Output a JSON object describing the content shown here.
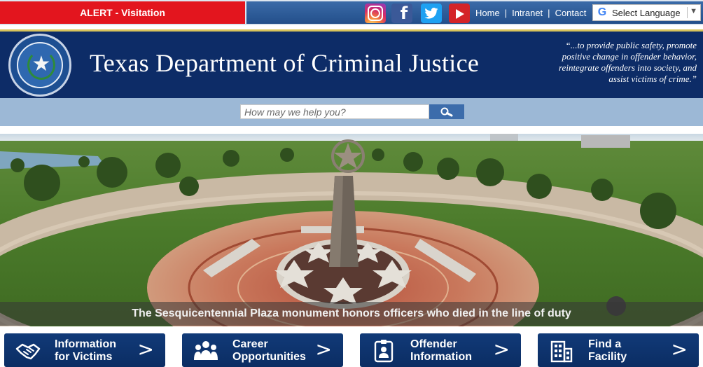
{
  "alert": {
    "label": "ALERT - Visitation"
  },
  "social": [
    {
      "name": "instagram",
      "icon": "instagram-icon"
    },
    {
      "name": "facebook",
      "icon": "facebook-icon",
      "glyph": "f"
    },
    {
      "name": "twitter",
      "icon": "twitter-icon"
    },
    {
      "name": "youtube",
      "icon": "youtube-icon"
    }
  ],
  "nav": {
    "home": "Home",
    "intranet": "Intranet",
    "contact": "Contact",
    "separator": "|"
  },
  "language": {
    "label": "Select Language",
    "google_glyph": "G",
    "arrow": "▼"
  },
  "header": {
    "title": "Texas Department of Criminal Justice",
    "motto_lines": [
      "“...to provide public safety, promote",
      "positive change in offender behavior,",
      "reintegrate offenders into society, and",
      "assist victims of crime.”"
    ],
    "seal_icon": "texas-seal-icon",
    "seal_star": "★"
  },
  "search": {
    "placeholder": "How may we help you?",
    "icon": "search-icon"
  },
  "hero": {
    "caption": "The Sesquicentennial Plaza monument honors officers who died in the line of duty"
  },
  "quick_links": [
    {
      "line1": "Information",
      "line2": "for Victims",
      "icon": "handshake-icon"
    },
    {
      "line1": "Career",
      "line2": "Opportunities",
      "icon": "people-icon"
    },
    {
      "line1": "Offender",
      "line2": "Information",
      "icon": "id-badge-icon"
    },
    {
      "line1": "Find a",
      "line2": "Facility",
      "icon": "building-icon"
    }
  ],
  "chevron": ">",
  "colors": {
    "alert": "#e3151e",
    "header_bg": "#0d2c67",
    "accent_gold": "#d7c35b",
    "search_bar": "#9cb8d6",
    "button_blue": "#113a78"
  }
}
